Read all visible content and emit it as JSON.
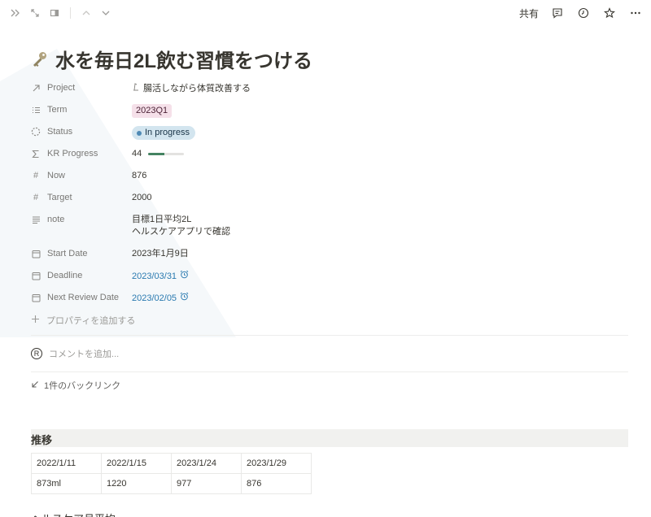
{
  "topbar": {
    "share_label": "共有"
  },
  "page": {
    "title": "水を毎日2L飲む習慣をつける"
  },
  "properties": [
    {
      "icon": "arrow-up-right-icon",
      "name": "Project",
      "value": "腸活しながら体質改善する",
      "kind": "relation"
    },
    {
      "icon": "list-icon",
      "name": "Term",
      "value": "2023Q1",
      "kind": "tag"
    },
    {
      "icon": "status-icon",
      "name": "Status",
      "value": "In progress",
      "kind": "status"
    },
    {
      "icon": "sigma-icon",
      "name": "KR Progress",
      "value": "44",
      "progress": 0.44,
      "kind": "progress"
    },
    {
      "icon": "hash-icon",
      "name": "Now",
      "value": "876",
      "kind": "number"
    },
    {
      "icon": "hash-icon",
      "name": "Target",
      "value": "2000",
      "kind": "number"
    },
    {
      "icon": "text-icon",
      "name": "note",
      "value": "目標1日平均2L",
      "value2": "ヘルスケアアプリで確認",
      "kind": "text"
    },
    {
      "icon": "calendar-icon",
      "name": "Start Date",
      "value": "2023年1月9日",
      "kind": "date"
    },
    {
      "icon": "calendar-icon",
      "name": "Deadline",
      "value": "2023/03/31",
      "kind": "date-link"
    },
    {
      "icon": "calendar-icon",
      "name": "Next Review Date",
      "value": "2023/02/05",
      "kind": "date-link"
    }
  ],
  "add_property_label": "プロパティを追加する",
  "comment_placeholder": "コメントを追加...",
  "comment_avatar": "R",
  "backlinks_label": "1件のバックリンク",
  "section": {
    "title": "推移",
    "table": [
      [
        "2022/1/11",
        "2022/1/15",
        "2023/1/24",
        "2023/1/29"
      ],
      [
        "873ml",
        "1220",
        "977",
        "876"
      ]
    ]
  },
  "subheading": "ヘルスケア月平均",
  "colors": {
    "accent_link": "#2a7ab0",
    "status_bg": "#d3e5ef",
    "tag_pink_bg": "#f5e0e9",
    "progress_fill": "#448361"
  }
}
